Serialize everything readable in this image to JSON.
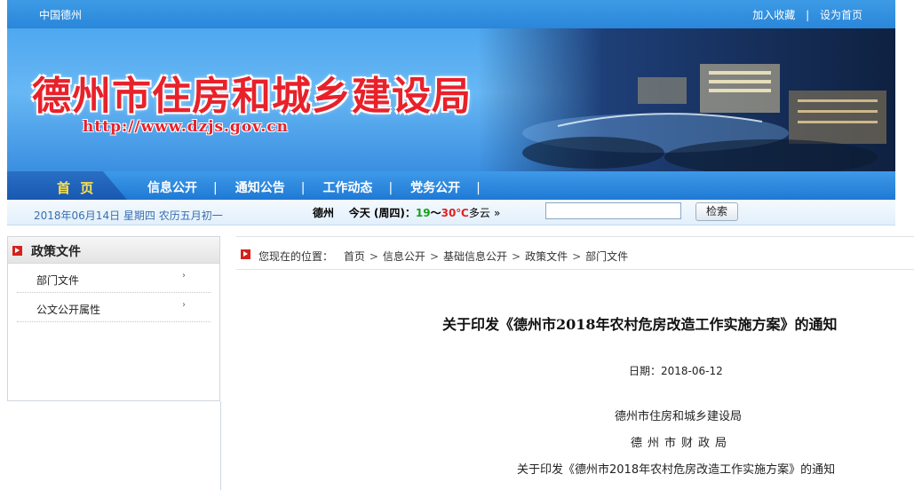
{
  "topbar": {
    "site_name": "中国德州",
    "add_favorite": "加入收藏",
    "separator": "|",
    "set_homepage": "设为首页"
  },
  "banner": {
    "title": "德州市住房和城乡建设局",
    "url": "http://www.dzjs.gov.cn"
  },
  "nav": {
    "home": "首 页",
    "items": [
      "信息公开",
      "通知公告",
      "工作动态",
      "党务公开"
    ],
    "separator": "|"
  },
  "infobar": {
    "date": "2018年06月14日  星期四  农历五月初一",
    "city": "德州",
    "today": "今天 (周四)：",
    "temp_low": "19",
    "range_sep": "～",
    "temp_high": "30℃",
    "condition": "多云",
    "more": "»",
    "search_value": "",
    "search_button": "检索"
  },
  "sidebar": {
    "title": "政策文件",
    "items": [
      {
        "label": "部门文件",
        "arrow": "›"
      },
      {
        "label": "公文公开属性",
        "arrow": "›"
      }
    ]
  },
  "breadcrumb": {
    "prefix": "您现在的位置：",
    "items": [
      "首页",
      "信息公开",
      "基础信息公开",
      "政策文件",
      "部门文件"
    ],
    "separator": ">"
  },
  "article": {
    "title": "关于印发《德州市2018年农村危房改造工作实施方案》的通知",
    "date": "日期：2018-06-12",
    "issuer1": "德州市住房和城乡建设局",
    "issuer2": "德州市财政局",
    "body_line1": "关于印发《德州市2018年农村危房改造工作实施方案》的通知"
  },
  "colors": {
    "brand_blue": "#2a86d9",
    "title_red": "#e8212a",
    "nav_home_text": "#ffe24a",
    "marker_red": "#d3231d"
  }
}
